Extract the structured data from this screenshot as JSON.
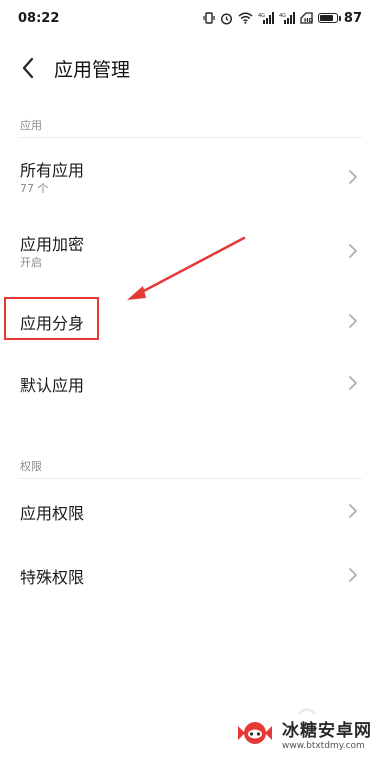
{
  "status_bar": {
    "time": "08:22",
    "battery": "87",
    "battery_level": 0.87,
    "icons": [
      "vibrate-icon",
      "alarm-icon",
      "wifi-icon",
      "signal-icon",
      "signal-icon",
      "hd-icon",
      "battery-icon"
    ]
  },
  "header": {
    "title": "应用管理"
  },
  "sections": {
    "apps": "应用",
    "permissions": "权限"
  },
  "rows": {
    "all_apps": {
      "title": "所有应用",
      "sub": "77 个"
    },
    "app_lock": {
      "title": "应用加密",
      "sub": "开启"
    },
    "app_clone": {
      "title": "应用分身"
    },
    "default_apps": {
      "title": "默认应用"
    },
    "app_permissions": {
      "title": "应用权限"
    },
    "special_permissions": {
      "title": "特殊权限"
    }
  },
  "annotation": {
    "color": "#e53935"
  },
  "watermark": {
    "name": "冰糖安卓网",
    "url": "www.btxtdmy.com"
  }
}
